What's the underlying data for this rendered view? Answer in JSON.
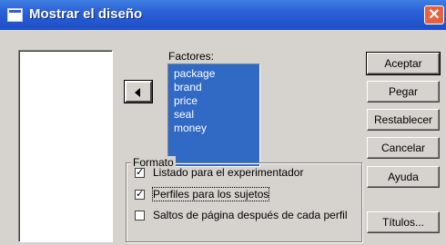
{
  "window": {
    "title": "Mostrar el diseño",
    "close_glyph": "✕"
  },
  "factors": {
    "label": "Factores:",
    "items": [
      "package",
      "brand",
      "price",
      "seal",
      "money"
    ]
  },
  "format_group": {
    "title": "Formato",
    "options": [
      {
        "label": "Listado para el experimentador",
        "checked": true,
        "glyph": "✓"
      },
      {
        "label": "Perfiles para los sujetos",
        "checked": true,
        "glyph": "✓"
      },
      {
        "label": "Saltos de página después de cada perfil",
        "checked": false,
        "glyph": ""
      }
    ]
  },
  "buttons": {
    "accept": "Aceptar",
    "paste": "Pegar",
    "reset": "Restablecer",
    "cancel": "Cancelar",
    "help": "Ayuda",
    "titles": "Títulos..."
  },
  "colors": {
    "titlebar": "#2b60d8",
    "selection": "#316ac5",
    "face": "#d6d3ce"
  }
}
